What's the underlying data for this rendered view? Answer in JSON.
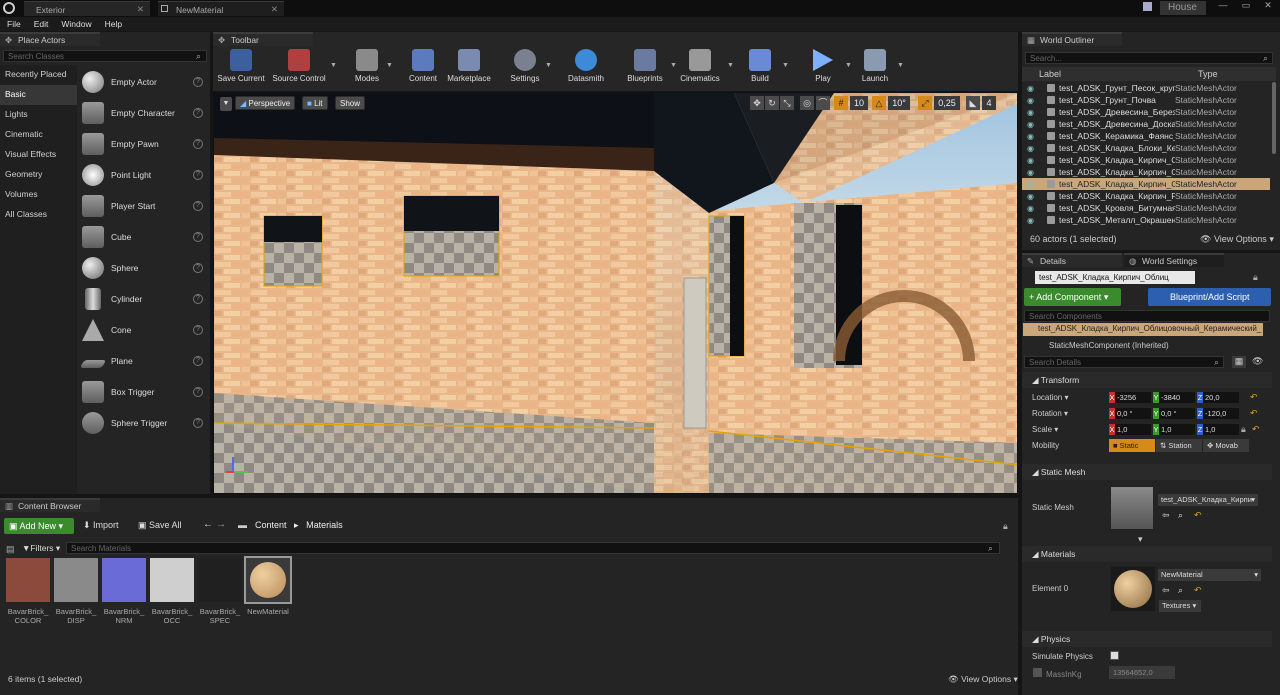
{
  "titlebar": {
    "tabs": [
      {
        "label": "Exterior"
      },
      {
        "label": "NewMaterial"
      }
    ],
    "project": "House"
  },
  "menu": [
    "File",
    "Edit",
    "Window",
    "Help"
  ],
  "place_actors": {
    "tab": "Place Actors",
    "search_placeholder": "Search Classes",
    "categories": [
      "Recently Placed",
      "Basic",
      "Lights",
      "Cinematic",
      "Visual Effects",
      "Geometry",
      "Volumes",
      "All Classes"
    ],
    "items": [
      "Empty Actor",
      "Empty Character",
      "Empty Pawn",
      "Point Light",
      "Player Start",
      "Cube",
      "Sphere",
      "Cylinder",
      "Cone",
      "Plane",
      "Box Trigger",
      "Sphere Trigger"
    ],
    "help": "?"
  },
  "toolbar": {
    "tab": "Toolbar",
    "buttons": [
      "Save Current",
      "Source Control",
      "Modes",
      "Content",
      "Marketplace",
      "Settings",
      "Datasmith",
      "Blueprints",
      "Cinematics",
      "Build",
      "Play",
      "Launch"
    ]
  },
  "viewport": {
    "perspective": "Perspective",
    "lit": "Lit",
    "show": "Show",
    "grid": "10",
    "angle": "10°",
    "scale": "0,25",
    "speed": "4"
  },
  "outliner": {
    "tab": "World Outliner",
    "search_placeholder": "Search...",
    "col_label": "Label",
    "col_type": "Type",
    "rows": [
      {
        "name": "test_ADSK_Грунт_Песок_крупный",
        "type": "StaticMeshActor"
      },
      {
        "name": "test_ADSK_Грунт_Почва",
        "type": "StaticMeshActor"
      },
      {
        "name": "test_ADSK_Древесина_Береза_ш",
        "type": "StaticMeshActor"
      },
      {
        "name": "test_ADSK_Древесина_Доска_п",
        "type": "StaticMeshActor"
      },
      {
        "name": "test_ADSK_Керамика_Фаянс_Б",
        "type": "StaticMeshActor"
      },
      {
        "name": "test_ADSK_Кладка_Блоки_Кера",
        "type": "StaticMeshActor"
      },
      {
        "name": "test_ADSK_Кладка_Кирпич_Обл",
        "type": "StaticMeshActor"
      },
      {
        "name": "test_ADSK_Кладка_Кирпич_Об",
        "type": "StaticMeshActor"
      },
      {
        "name": "test_ADSK_Кладка_Кирпич_Об",
        "type": "StaticMeshActor",
        "selected": true
      },
      {
        "name": "test_ADSK_Кладка_Кирпич_Ря",
        "type": "StaticMeshActor"
      },
      {
        "name": "test_ADSK_Кровля_Битумная_П",
        "type": "StaticMeshActor"
      },
      {
        "name": "test_ADSK_Металл_Окрашенный",
        "type": "StaticMeshActor"
      }
    ],
    "count": "60 actors (1 selected)",
    "view_options": "View Options"
  },
  "details": {
    "tab": "Details",
    "tab2": "World Settings",
    "actor_name": "test_ADSK_Кладка_Кирпич_Облиц",
    "add_component": "+ Add Component",
    "blueprint": "Blueprint/Add Script",
    "search_components": "Search Components",
    "root_component": "test_ADSK_Кладка_Кирпич_Облицовочный_Керамический_",
    "mesh_component": "StaticMeshComponent (Inherited)",
    "search_details": "Search Details",
    "transform": "Transform",
    "location": "Location",
    "rotation": "Rotation",
    "scale": "Scale",
    "mobility": "Mobility",
    "loc": [
      "-3256",
      "-3840",
      "20,0"
    ],
    "rot": [
      "0,0 °",
      "0,0 °",
      "-120,0"
    ],
    "scl": [
      "1,0",
      "1,0",
      "1,0"
    ],
    "mob": [
      "Static",
      "Station",
      "Movab"
    ],
    "static_mesh_h": "Static Mesh",
    "static_mesh": "Static Mesh",
    "mesh_value": "test_ADSK_Кладка_Кирпи",
    "materials_h": "Materials",
    "element": "Element 0",
    "material_value": "NewMaterial",
    "textures": "Textures",
    "physics_h": "Physics",
    "simulate": "Simulate Physics",
    "mass": "MassInKg",
    "mass_value": "13564652,0"
  },
  "content_browser": {
    "tab": "Content Browser",
    "add_new": "Add New",
    "import": "Import",
    "save_all": "Save All",
    "path": [
      "Content",
      "Materials"
    ],
    "filters": "Filters",
    "search_placeholder": "Search Materials",
    "assets": [
      {
        "l1": "BavarBrick_",
        "l2": "COLOR",
        "color": "#8c4a3c"
      },
      {
        "l1": "BavarBrick_",
        "l2": "DISP",
        "color": "#8a8a8a"
      },
      {
        "l1": "BavarBrick_",
        "l2": "NRM",
        "color": "#6b6bd8"
      },
      {
        "l1": "BavarBrick_",
        "l2": "OCC",
        "color": "#cfcfcf"
      },
      {
        "l1": "BavarBrick_",
        "l2": "SPEC",
        "color": "#202020"
      },
      {
        "l1": "NewMaterial",
        "l2": "",
        "color": "#b88a5a"
      }
    ],
    "count": "6 items (1 selected)",
    "view_options": "View Options"
  }
}
